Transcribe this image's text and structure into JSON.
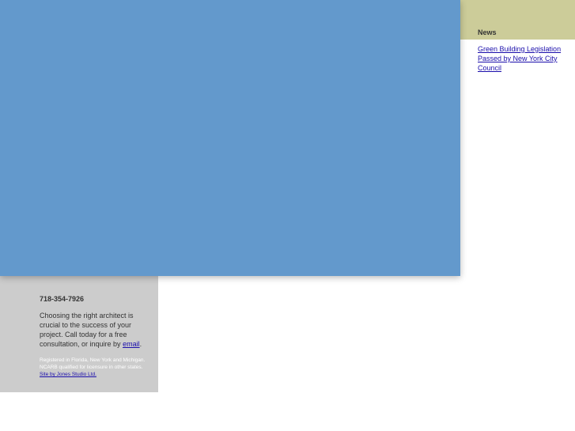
{
  "colors": {
    "hero_blue": "#6399cc",
    "news_band": "#cccc99",
    "contact_panel": "#cccccc",
    "link": "#1a0dab"
  },
  "news": {
    "title": "News",
    "items": [
      {
        "label": "Green Building Legislation Passed by New York City Council"
      }
    ]
  },
  "contact": {
    "phone": "718-354-7926",
    "pitch_text": "Choosing the right architect is crucial to the success of your project. Call today for a free consultation, or inquire by ",
    "email_link": "email",
    "pitch_end": ".",
    "registration": "Registered in Florida, New York and Michigan. NCARB qualified for licensure in other states.",
    "credit_link": "Site by Jones Studio Ltd."
  }
}
